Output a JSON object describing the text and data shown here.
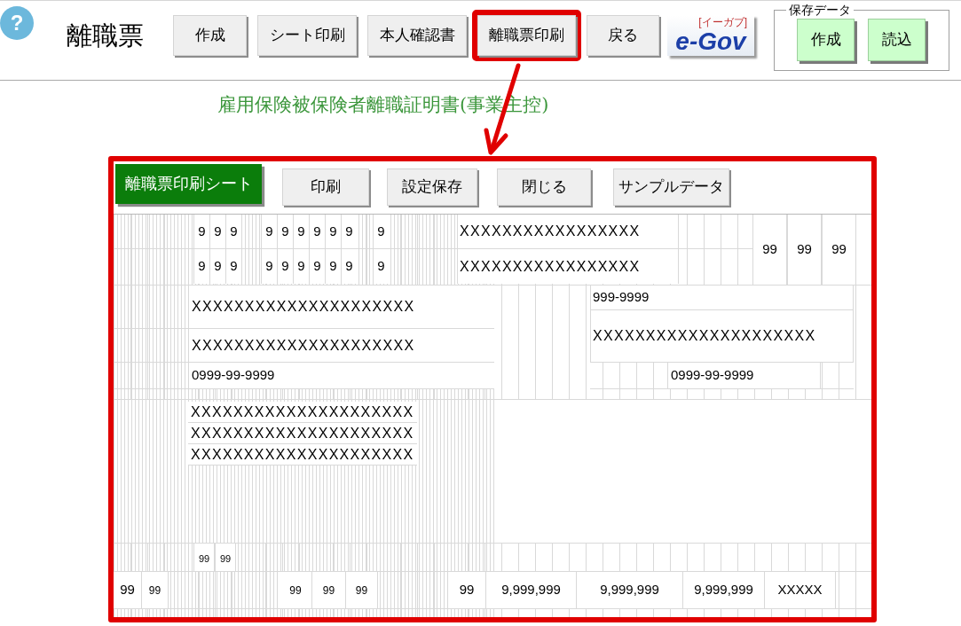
{
  "help_button": "?",
  "app_title": "離職票",
  "toolbar": [
    {
      "label": "作成",
      "highlighted": false
    },
    {
      "label": "シート印刷",
      "highlighted": false
    },
    {
      "label": "本人確認書",
      "highlighted": false
    },
    {
      "label": "離職票印刷",
      "highlighted": true
    },
    {
      "label": "戻る",
      "highlighted": false
    }
  ],
  "logo": {
    "reading": "[イーガブ]",
    "text": "e-Gov"
  },
  "saved_data": {
    "legend": "保存データ",
    "buttons": [
      "作成",
      "読込"
    ]
  },
  "form_title": "雇用保険被保険者離職証明書(事業主控)",
  "print_sheet": {
    "highlighted": true,
    "title": "離職票印刷シート",
    "buttons": [
      "印刷",
      "設定保存",
      "閉じる",
      "サンプルデータ"
    ],
    "sheet": {
      "number_rows": [
        {
          "column_1": [
            "9",
            "9",
            "9"
          ],
          "column_2": [
            "9",
            "9",
            "9",
            "9",
            "9",
            "9"
          ],
          "column_3": [
            "9"
          ],
          "column_4": "XXXXXXXXXXXXXXXXX"
        },
        {
          "column_1": [
            "9",
            "9",
            "9"
          ],
          "column_2": [
            "9",
            "9",
            "9",
            "9",
            "9",
            "9"
          ],
          "column_3": [
            "9"
          ],
          "column_4": "XXXXXXXXXXXXXXXXX"
        }
      ],
      "column_5": [
        "99",
        "99",
        "99"
      ],
      "left_rows": [
        "XXXXXXXXXXXXXXXXXXXXX",
        "XXXXXXXXXXXXXXXXXXXXX",
        "0999-99-9999"
      ],
      "right_rows": [
        "999-9999",
        "XXXXXXXXXXXXXXXXXXXXX",
        "0999-99-9999"
      ],
      "lines": [
        "XXXXXXXXXXXXXXXXXXXXX",
        "XXXXXXXXXXXXXXXXXXXXX",
        "XXXXXXXXXXXXXXXXXXXXX"
      ],
      "small_cells": [
        "99",
        "99"
      ],
      "bottom_row": [
        "99",
        "99",
        "99",
        "99",
        "99",
        "99",
        "9,999,999",
        "9,999,999",
        "9,999,999",
        "XXXXX"
      ]
    }
  }
}
